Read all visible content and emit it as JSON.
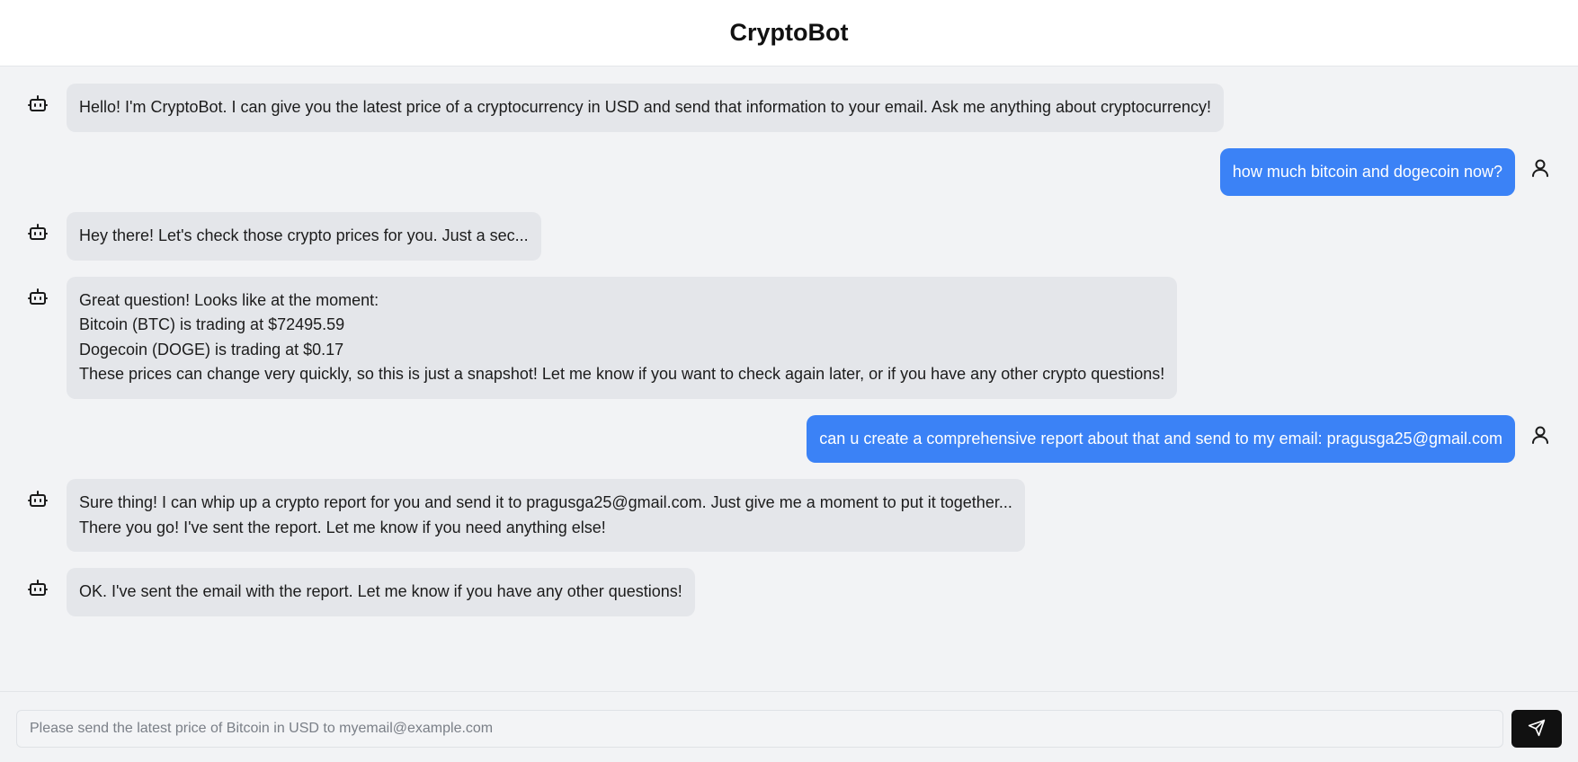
{
  "app": {
    "title": "CryptoBot"
  },
  "messages": [
    {
      "role": "bot",
      "lines": [
        "Hello! I'm CryptoBot. I can give you the latest price of a cryptocurrency in USD and send that information to your email. Ask me anything about cryptocurrency!"
      ]
    },
    {
      "role": "user",
      "lines": [
        "how much bitcoin and dogecoin now?"
      ]
    },
    {
      "role": "bot",
      "lines": [
        "Hey there! Let's check those crypto prices for you. Just a sec..."
      ]
    },
    {
      "role": "bot",
      "lines": [
        "Great question! Looks like at the moment:",
        "Bitcoin (BTC) is trading at $72495.59",
        "Dogecoin (DOGE) is trading at $0.17",
        "These prices can change very quickly, so this is just a snapshot! Let me know if you want to check again later, or if you have any other crypto questions!"
      ]
    },
    {
      "role": "user",
      "lines": [
        "can u create a comprehensive report about that and send to my email: pragusga25@gmail.com"
      ]
    },
    {
      "role": "bot",
      "lines": [
        "Sure thing! I can whip up a crypto report for you and send it to pragusga25@gmail.com. Just give me a moment to put it together...",
        "There you go! I've sent the report. Let me know if you need anything else!"
      ]
    },
    {
      "role": "bot",
      "lines": [
        "OK. I've sent the email with the report. Let me know if you have any other questions!"
      ]
    }
  ],
  "composer": {
    "placeholder": "Please send the latest price of Bitcoin in USD to myemail@example.com",
    "value": "",
    "send_icon": "send-icon"
  },
  "icons": {
    "bot": "bot-icon",
    "user": "user-icon"
  },
  "colors": {
    "user_bubble": "#3b82f6",
    "bot_bubble": "#e4e6ea",
    "send_button": "#111111",
    "background": "#f2f3f5"
  }
}
